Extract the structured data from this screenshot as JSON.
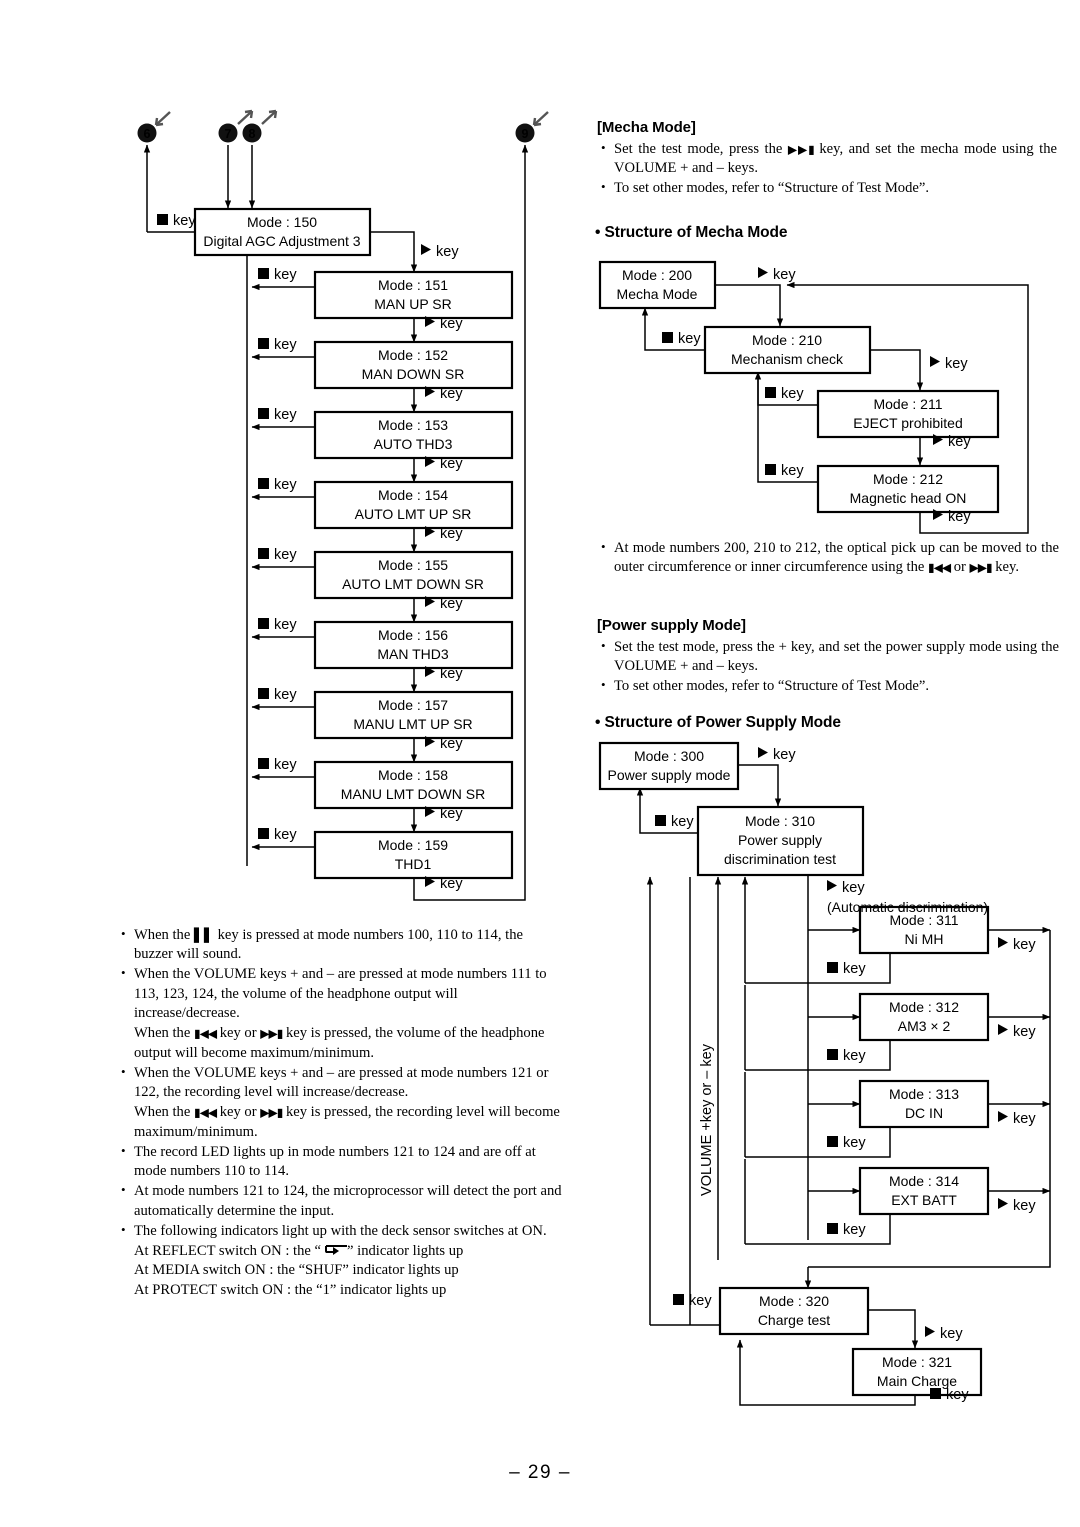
{
  "page": {
    "number": "– 29 –"
  },
  "markers": [
    {
      "id": "6",
      "label": "6",
      "arrow": "down-left"
    },
    {
      "id": "7",
      "label": "7",
      "arrow": "up-right"
    },
    {
      "id": "8",
      "label": "8",
      "arrow": "up-right"
    },
    {
      "id": "9",
      "label": "9",
      "arrow": "down-left"
    }
  ],
  "labels": {
    "stop_key": "key",
    "play_key": "key",
    "auto_discrimination": "(Automatic discrimination)",
    "volume_axis": "VOLUME +key or – key"
  },
  "test_mode_chart": {
    "head": {
      "mode": "Mode : 150",
      "name": "Digital AGC Adjustment 3"
    },
    "boxes": [
      {
        "mode": "Mode : 151",
        "name": "MAN UP SR"
      },
      {
        "mode": "Mode : 152",
        "name": "MAN DOWN SR"
      },
      {
        "mode": "Mode : 153",
        "name": "AUTO THD3"
      },
      {
        "mode": "Mode : 154",
        "name": "AUTO LMT UP SR"
      },
      {
        "mode": "Mode : 155",
        "name": "AUTO LMT DOWN SR"
      },
      {
        "mode": "Mode : 156",
        "name": "MAN THD3"
      },
      {
        "mode": "Mode : 157",
        "name": "MANU LMT UP SR"
      },
      {
        "mode": "Mode : 158",
        "name": "MANU LMT DOWN SR"
      },
      {
        "mode": "Mode : 159",
        "name": "THD1"
      }
    ]
  },
  "left_notes": [
    {
      "kind": "bullet",
      "parts": [
        {
          "t": "text",
          "v": "When the "
        },
        {
          "t": "glyph",
          "v": "pause"
        },
        {
          "t": "text",
          "v": " key is pressed at mode numbers 100, 110 to 114, the buzzer will sound."
        }
      ]
    },
    {
      "kind": "bullet",
      "parts": [
        {
          "t": "text",
          "v": "When the VOLUME keys + and – are pressed at mode numbers 111 to 113, 123, 124, the volume of the headphone output will increase/decrease."
        }
      ]
    },
    {
      "kind": "sub",
      "parts": [
        {
          "t": "text",
          "v": "When the "
        },
        {
          "t": "glyph",
          "v": "prev"
        },
        {
          "t": "text",
          "v": " key or "
        },
        {
          "t": "glyph",
          "v": "next"
        },
        {
          "t": "text",
          "v": " key is pressed, the volume of the headphone output will become maximum/minimum."
        }
      ]
    },
    {
      "kind": "bullet",
      "parts": [
        {
          "t": "text",
          "v": "When the VOLUME keys + and – are pressed at mode numbers 121 or 122, the recording level will increase/decrease."
        }
      ]
    },
    {
      "kind": "sub",
      "parts": [
        {
          "t": "text",
          "v": "When the "
        },
        {
          "t": "glyph",
          "v": "prev"
        },
        {
          "t": "text",
          "v": " key or "
        },
        {
          "t": "glyph",
          "v": "next"
        },
        {
          "t": "text",
          "v": " key is pressed, the recording level will become maximum/minimum."
        }
      ]
    },
    {
      "kind": "bullet",
      "parts": [
        {
          "t": "text",
          "v": "The record LED lights up in mode numbers 121 to 124 and are off at mode numbers 110 to 114."
        }
      ]
    },
    {
      "kind": "bullet",
      "parts": [
        {
          "t": "text",
          "v": "At mode numbers 121 to 124, the microprocessor will detect the port and automatically determine the input."
        }
      ]
    },
    {
      "kind": "bullet",
      "parts": [
        {
          "t": "text",
          "v": "The following indicators light up with the deck sensor switches at ON."
        }
      ]
    },
    {
      "kind": "sub",
      "parts": [
        {
          "t": "text",
          "v": "At REFLECT switch ON : the “"
        },
        {
          "t": "glyph",
          "v": "loop"
        },
        {
          "t": "text",
          "v": "” indicator lights up"
        }
      ]
    },
    {
      "kind": "sub",
      "parts": [
        {
          "t": "text",
          "v": "At MEDIA switch ON : the “SHUF” indicator lights up"
        }
      ]
    },
    {
      "kind": "sub",
      "parts": [
        {
          "t": "text",
          "v": "At PROTECT switch ON : the “1” indicator lights up"
        }
      ]
    }
  ],
  "mecha": {
    "heading": "[Mecha Mode]",
    "notes": [
      {
        "kind": "bullet",
        "parts": [
          {
            "t": "text",
            "v": "Set the test mode, press the "
          },
          {
            "t": "glyph",
            "v": "next"
          },
          {
            "t": "text",
            "v": " key, and set the mecha mode using the VOLUME + and – keys."
          }
        ]
      },
      {
        "kind": "bullet",
        "parts": [
          {
            "t": "text",
            "v": "To set other modes, refer to “Structure of Test Mode”."
          }
        ]
      }
    ],
    "structure_heading": "• Structure of Mecha Mode",
    "boxes": [
      {
        "mode": "Mode : 200",
        "name": "Mecha Mode"
      },
      {
        "mode": "Mode : 210",
        "name": "Mechanism check"
      },
      {
        "mode": "Mode : 211",
        "name": "EJECT prohibited"
      },
      {
        "mode": "Mode : 212",
        "name": "Magnetic head ON"
      }
    ],
    "after_notes": [
      {
        "kind": "bullet",
        "parts": [
          {
            "t": "text",
            "v": "At mode numbers 200, 210 to 212, the optical pick up can be moved to the outer circumference or inner circumference using the "
          },
          {
            "t": "glyph",
            "v": "prev"
          },
          {
            "t": "text",
            "v": " or "
          },
          {
            "t": "glyph",
            "v": "next"
          },
          {
            "t": "text",
            "v": " key."
          }
        ]
      }
    ]
  },
  "power": {
    "heading": "[Power supply Mode]",
    "notes": [
      {
        "kind": "bullet",
        "parts": [
          {
            "t": "text",
            "v": "Set the test mode, press the + key, and set the power supply mode using the VOLUME + and – keys."
          }
        ]
      },
      {
        "kind": "bullet",
        "parts": [
          {
            "t": "text",
            "v": "To set other modes, refer to “Structure of Test Mode”."
          }
        ]
      }
    ],
    "structure_heading": "• Structure of Power Supply Mode",
    "boxes": [
      {
        "mode": "Mode : 300",
        "name": "Power supply mode"
      },
      {
        "mode": "Mode : 310",
        "name": "Power supply",
        "name2": "discrimination test"
      },
      {
        "mode": "Mode : 311",
        "name": "Ni MH"
      },
      {
        "mode": "Mode : 312",
        "name": "AM3 × 2"
      },
      {
        "mode": "Mode : 313",
        "name": "DC IN"
      },
      {
        "mode": "Mode : 314",
        "name": "EXT BATT"
      },
      {
        "mode": "Mode : 320",
        "name": "Charge test"
      },
      {
        "mode": "Mode : 321",
        "name": "Main Charge"
      }
    ]
  }
}
